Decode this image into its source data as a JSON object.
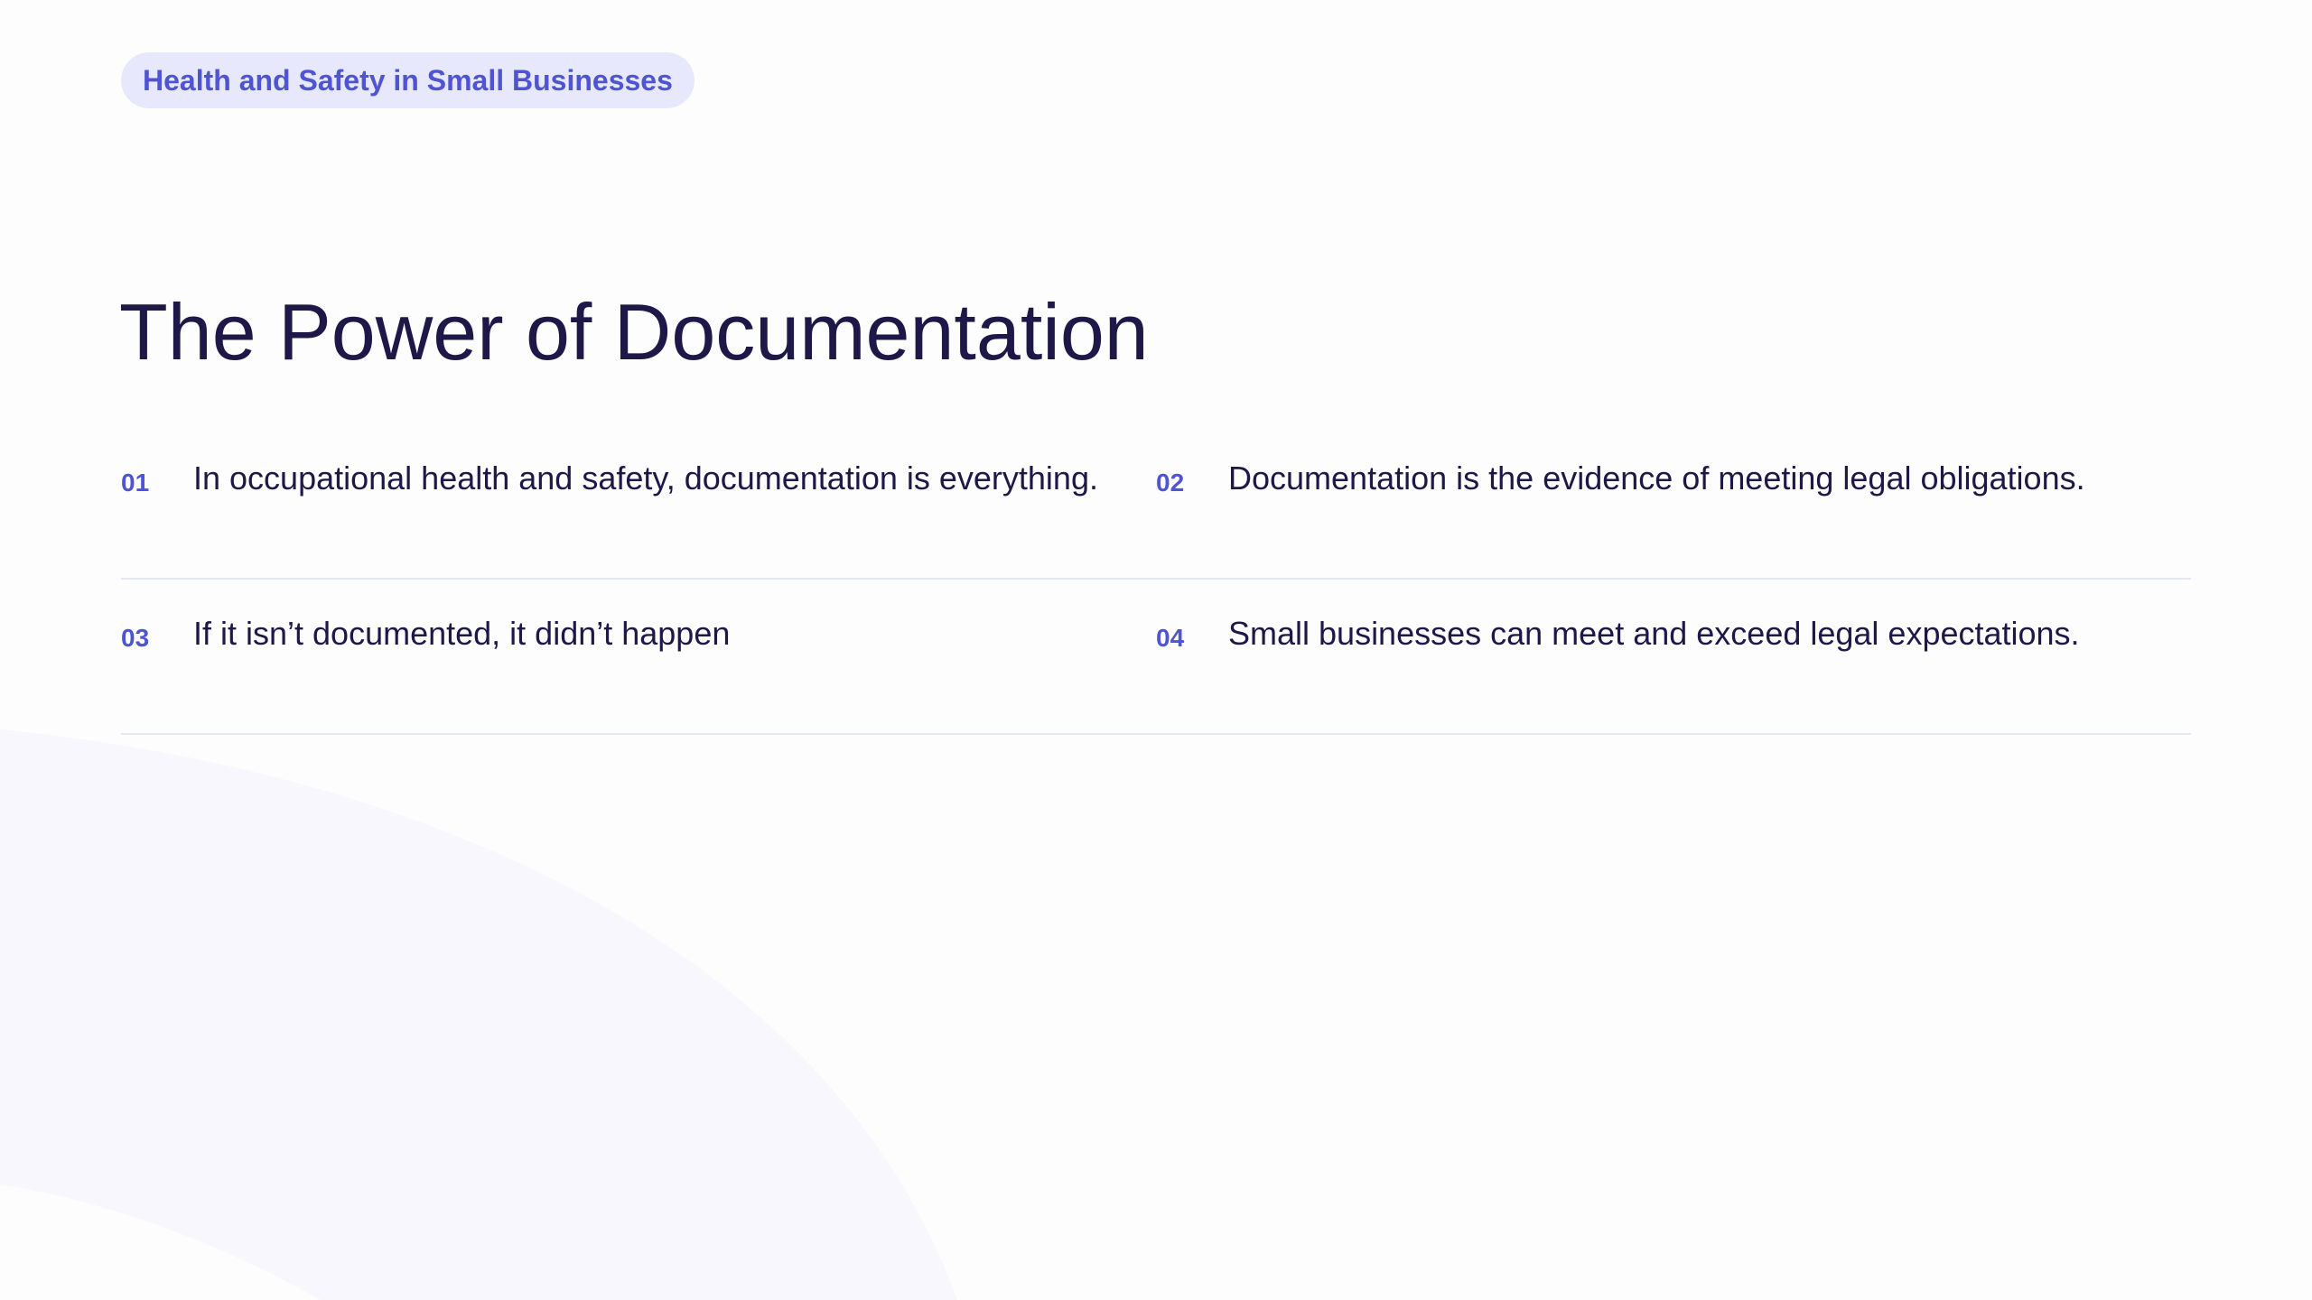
{
  "header": {
    "tag_label": "Health and Safety in Small Businesses"
  },
  "slide": {
    "title": "The Power of Documentation",
    "items": [
      {
        "number": "01",
        "text": "In occupational health and safety, documentation is everything."
      },
      {
        "number": "02",
        "text": "Documentation is the evidence of meeting legal obligations."
      },
      {
        "number": "03",
        "text": "If it isn’t documented, it didn’t happen"
      },
      {
        "number": "04",
        "text": "Small businesses can meet and exceed legal expectations."
      }
    ]
  },
  "colors": {
    "accent": "#4f54d3",
    "tag_background": "#e7e8fb",
    "title_text": "#1d1848",
    "background": "#fdfdfe",
    "arc": "#f7f7fd"
  }
}
